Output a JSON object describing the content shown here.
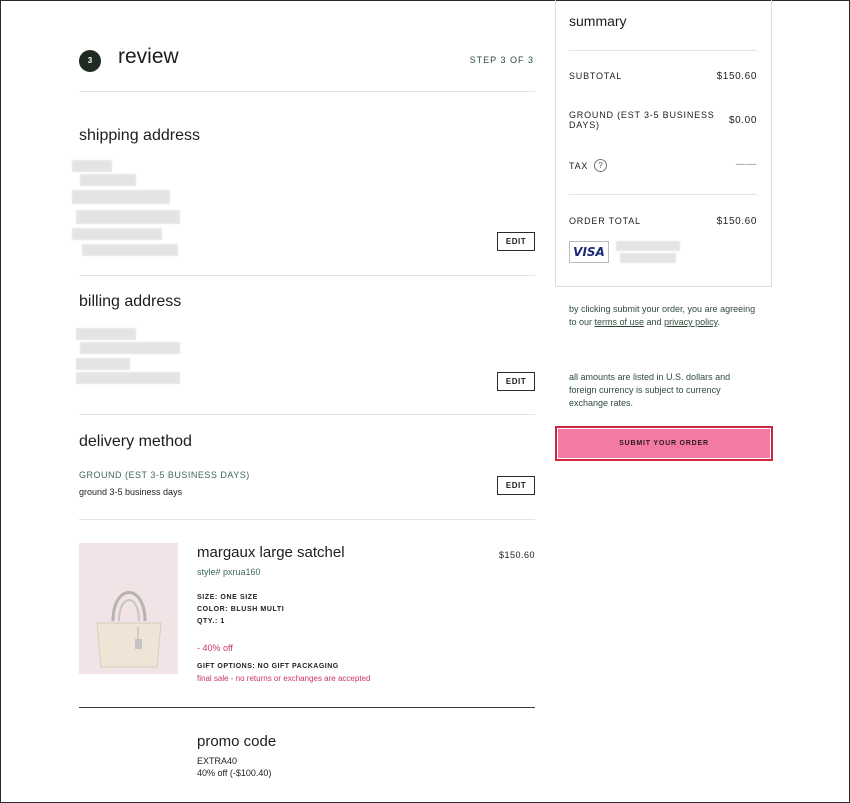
{
  "review": {
    "step_number": "3",
    "title": "review",
    "step_label": "STEP 3 OF 3"
  },
  "shipping": {
    "title": "shipping address",
    "edit_label": "EDIT"
  },
  "billing": {
    "title": "billing address",
    "edit_label": "EDIT"
  },
  "delivery": {
    "title": "delivery method",
    "method": "GROUND (EST 3-5 BUSINESS DAYS)",
    "detail": "ground 3-5 business days",
    "edit_label": "EDIT"
  },
  "product": {
    "name": "margaux large satchel",
    "style": "style# pxrua160",
    "price": "$150.60",
    "size": "SIZE: ONE SIZE",
    "color": "COLOR: BLUSH MULTI",
    "qty": "QTY.: 1",
    "discount": "- 40% off",
    "gift_options": "GIFT OPTIONS: NO GIFT PACKAGING",
    "final_sale": "final sale - no returns or exchanges are accepted"
  },
  "promo": {
    "title": "promo code",
    "code": "EXTRA40",
    "detail": "40% off (-$100.40)"
  },
  "summary": {
    "title": "summary",
    "subtotal_label": "SUBTOTAL",
    "subtotal_value": "$150.60",
    "shipping_label": "GROUND (EST 3-5 BUSINESS DAYS)",
    "shipping_value": "$0.00",
    "tax_label": "TAX",
    "tax_help": "?",
    "tax_value": "——",
    "total_label": "ORDER TOTAL",
    "total_value": "$150.60",
    "card_brand": "VISA"
  },
  "legal": {
    "prefix": "by clicking submit your order, you are agreeing to our ",
    "terms_link": "terms of use",
    "and": " and ",
    "privacy_link": "privacy policy",
    "suffix": ".",
    "currency_note": "all amounts are listed in U.S. dollars and foreign currency is subject to currency exchange rates."
  },
  "submit": {
    "label": "SUBMIT YOUR ORDER"
  },
  "colors": {
    "accent_green": "#3d6b58",
    "submit_pink": "#f47aa2",
    "highlight_red": "#d0263a",
    "sale_pink": "#c8336b"
  }
}
